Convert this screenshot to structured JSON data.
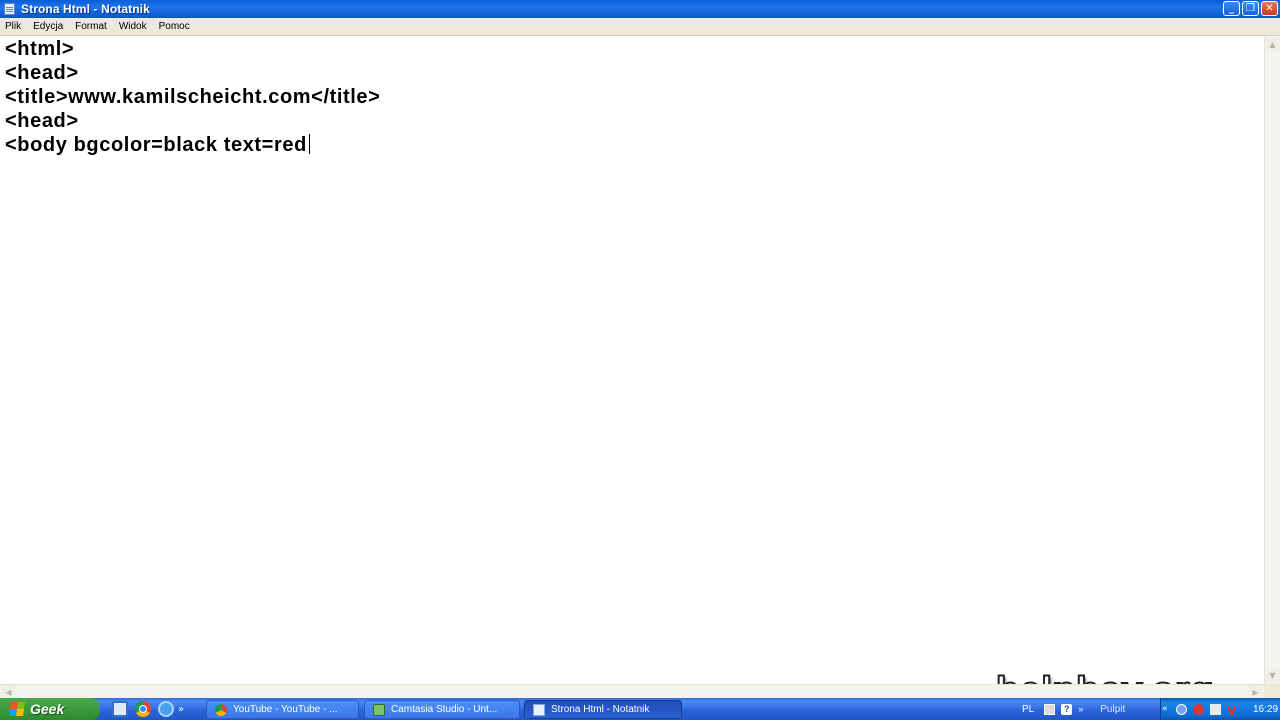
{
  "window": {
    "title": "Strona Html - Notatnik",
    "buttons": {
      "minimize": "_",
      "maximize": "❐",
      "close": "✕"
    }
  },
  "menu": {
    "items": [
      "Plik",
      "Edycja",
      "Format",
      "Widok",
      "Pomoc"
    ]
  },
  "editor": {
    "lines": [
      "<html>",
      "<head>",
      "<title>www.kamilscheicht.com</title>",
      "<head>",
      "<body bgcolor=black text=red"
    ]
  },
  "watermark": "helpbay.org",
  "taskbar": {
    "start_label": "Geek",
    "quick_launch": [
      "desktop-icon",
      "chrome-icon",
      "ie-icon"
    ],
    "tasks": [
      {
        "label": "YouTube - YouTube - ...",
        "icon": "chrome-icon",
        "active": false
      },
      {
        "label": "Camtasia Studio - Unt...",
        "icon": "camtasia-icon",
        "active": false
      },
      {
        "label": "Strona Html - Notatnik",
        "icon": "notepad-icon",
        "active": true
      }
    ],
    "tray": {
      "language": "PL",
      "desktop_label": "Pulpit",
      "clock": "16:29"
    }
  },
  "colors": {
    "titlebar": "#0a5fd8",
    "menubar": "#ece9d8",
    "start_button": "#3b9a3b",
    "taskbar": "#2a62d6"
  }
}
